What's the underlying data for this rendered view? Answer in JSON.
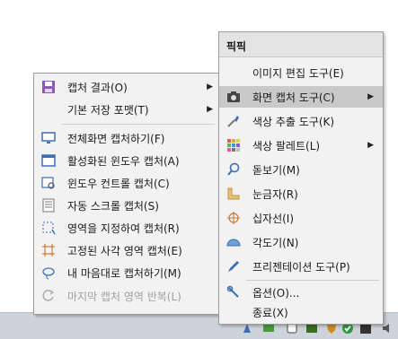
{
  "context_menu": {
    "header": "픽픽",
    "items": [
      {
        "label": "이미지 편집 도구(E)"
      },
      {
        "label": "화면 캡처 도구(C)",
        "has_submenu": true,
        "highlighted": true
      },
      {
        "label": "색상 추출 도구(K)"
      },
      {
        "label": "색상 팔레트(L)",
        "has_submenu": true
      },
      {
        "label": "돋보기(M)"
      },
      {
        "label": "눈금자(R)"
      },
      {
        "label": "십자선(I)"
      },
      {
        "label": "각도기(N)"
      },
      {
        "label": "프리젠테이션 도구(P)"
      },
      {
        "label": "옵션(O)..."
      },
      {
        "label": "종료(X)"
      }
    ]
  },
  "capture_submenu": {
    "items": [
      {
        "label": "캡처 결과(O)",
        "has_submenu": true
      },
      {
        "label": "기본 저장 포맷(T)",
        "has_submenu": true
      },
      {
        "label": "전체화면 캡처하기(F)"
      },
      {
        "label": "활성화된 윈도우 캡처(A)"
      },
      {
        "label": "윈도우 컨트롤 캡처(C)"
      },
      {
        "label": "자동 스크롤 캡처(S)"
      },
      {
        "label": "영역을 지정하여 캡처(R)"
      },
      {
        "label": "고정된 사각 영역 캡처(E)"
      },
      {
        "label": "내 마음대로 캡처하기(M)"
      },
      {
        "label": "마지막 캡처 영역 반복(L)",
        "disabled": true
      }
    ]
  },
  "colors": {
    "highlight": "#c9c9c9",
    "menu_bg": "#f2f2f2",
    "disabled_text": "#a0a0a0",
    "accent_blue": "#3d6fb6"
  }
}
